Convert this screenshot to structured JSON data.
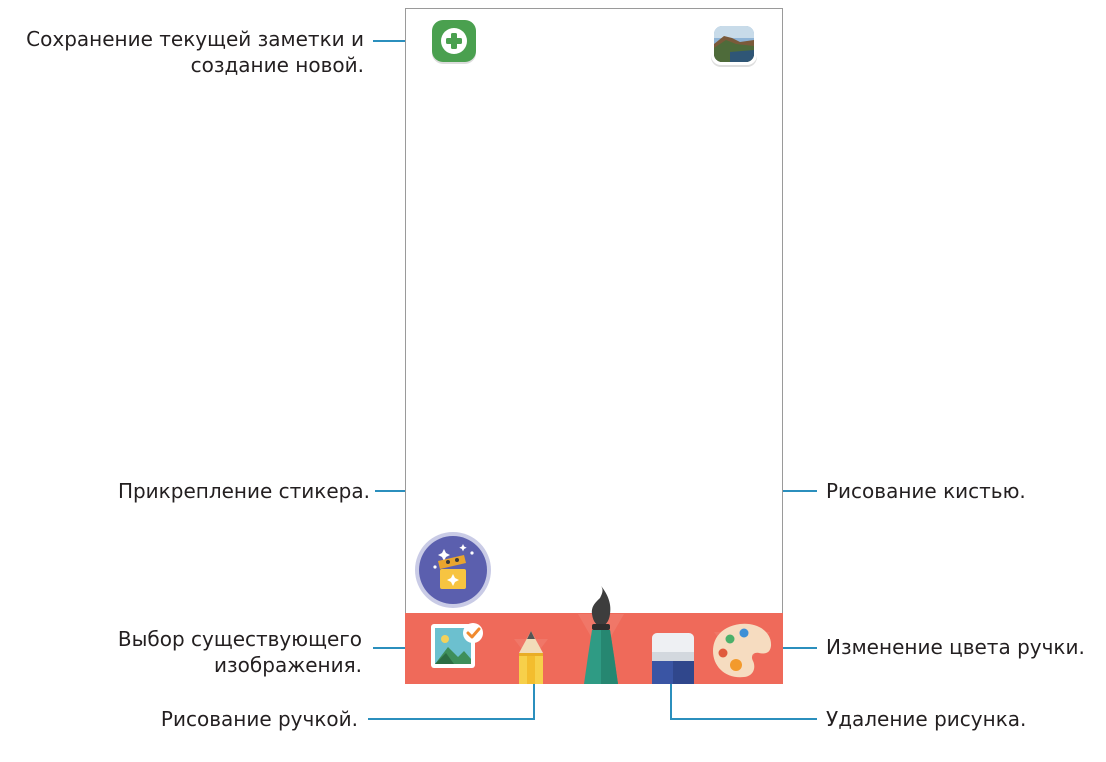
{
  "callouts": {
    "save_new": [
      "Сохранение текущей заметки и",
      "создание новой."
    ],
    "sticker": "Прикрепление стикера.",
    "brush": "Рисование кистью.",
    "existing_image": [
      "Выбор существующего",
      "изображения."
    ],
    "pen_color": "Изменение цвета ручки.",
    "pen": "Рисование ручкой.",
    "eraser": "Удаление рисунка."
  },
  "colors": {
    "accent_line": "#2b8fbd",
    "toolbar": "#ef6a5a",
    "add_button": "#4aa04f",
    "sticker_button": "#5b5fae"
  },
  "icons": {
    "add": "plus-icon",
    "gallery": "landscape-photo-icon",
    "sticker": "sticker-box-icon",
    "image": "picture-check-icon",
    "pen": "pencil-icon",
    "brush": "paint-brush-icon",
    "eraser": "eraser-icon",
    "palette": "palette-icon"
  }
}
